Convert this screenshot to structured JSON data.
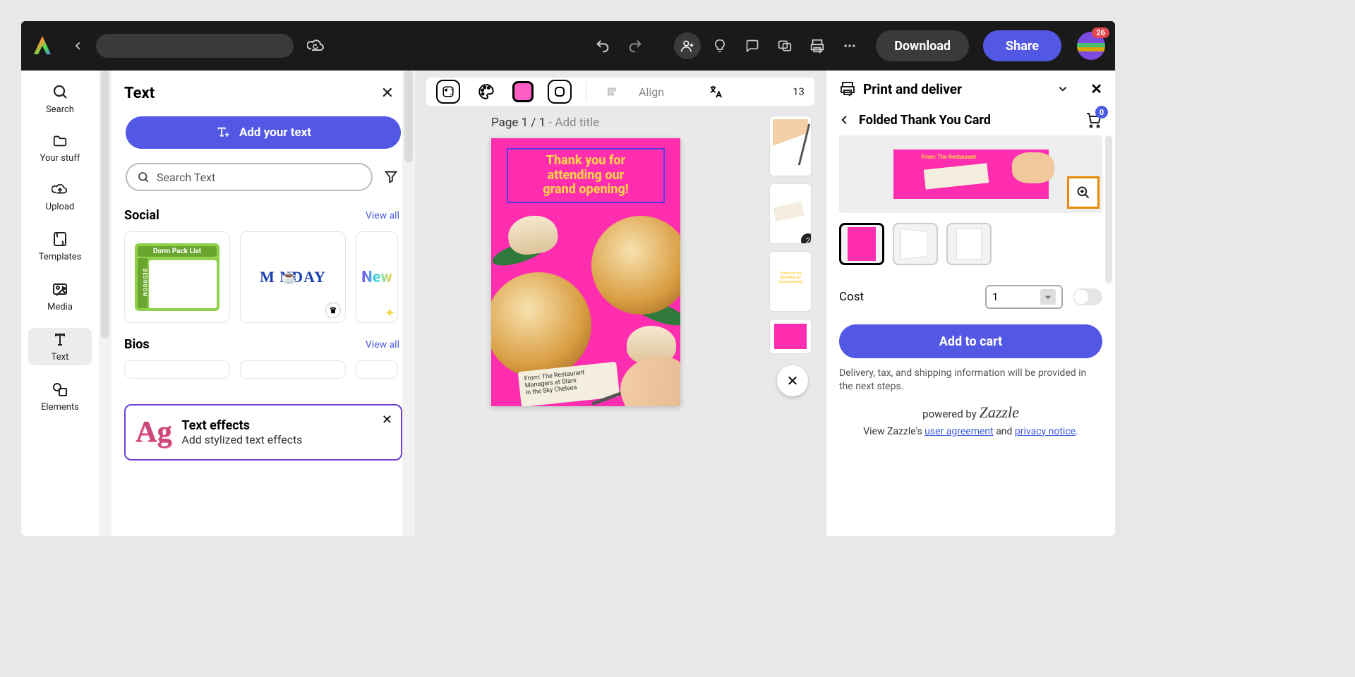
{
  "topbar": {
    "download": "Download",
    "share": "Share",
    "notif_count": "26"
  },
  "leftrail": {
    "search": "Search",
    "your_stuff": "Your stuff",
    "upload": "Upload",
    "templates": "Templates",
    "media": "Media",
    "text": "Text",
    "elements": "Elements"
  },
  "textpanel": {
    "title": "Text",
    "add_btn": "Add your text",
    "search_ph": "Search Text",
    "social_title": "Social",
    "bios_title": "Bios",
    "viewall": "View all",
    "thumb1_title": "Dorm Pack List",
    "thumb1_side": "BEDROOM",
    "thumb2": "M   NDAY",
    "thumb3": "New",
    "promo_title": "Text effects",
    "promo_sub": "Add stylized text effects"
  },
  "canvas": {
    "align": "Align",
    "zoom": "13",
    "page_label": "Page 1 / 1",
    "page_hint": " - Add title",
    "headline_l1": "Thank you for",
    "headline_l2": "attending our",
    "headline_l3": "grand opening!",
    "tag_l1": "From: The Restaurant",
    "tag_l2": "Managers at Stars",
    "tag_l3": "in the Sky Chelsea",
    "th_badge": "2",
    "mini_head": "Thank you for attending our grand opening!"
  },
  "print": {
    "title": "Print and deliver",
    "subtitle": "Folded Thank You Card",
    "cart_count": "0",
    "cost": "Cost",
    "qty": "1",
    "add": "Add to cart",
    "fine": "Delivery, tax, and shipping information will be provided in the next steps.",
    "powered_pre": "powered by ",
    "powered_brand": "Zazzle",
    "legal_pre": "View Zazzle's ",
    "legal_ua": "user agreement",
    "legal_and": " and ",
    "legal_pn": "privacy notice",
    "legal_end": "."
  }
}
